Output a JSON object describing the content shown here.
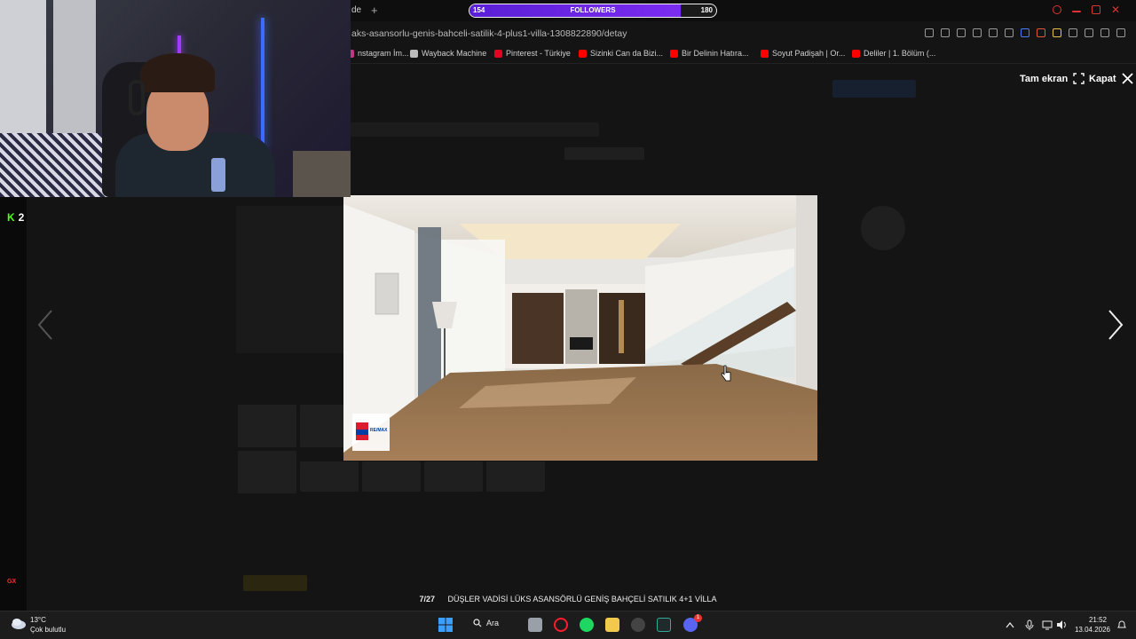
{
  "stream": {
    "followers_label": "FOLLOWERS",
    "followers_current": "154",
    "followers_goal": "180",
    "followers_progress": 0.855,
    "kick_viewers": "2"
  },
  "browser": {
    "tab_fragment": "de",
    "url": "aks-asansorlu-genis-bahceli-satilik-4-plus1-villa-1308822890/detay",
    "bookmarks": [
      {
        "label": "nstagram İm...",
        "icon": "instagram-icon",
        "color": "#c13584"
      },
      {
        "label": "Wayback Machine",
        "icon": "wayback-icon",
        "color": "#bbbbbb"
      },
      {
        "label": "Pinterest - Türkiye",
        "icon": "pinterest-icon",
        "color": "#e60023"
      },
      {
        "label": "Sizinki Can da Bizi...",
        "icon": "youtube-icon",
        "color": "#ff0000"
      },
      {
        "label": "Bir Delinin Hatıra...",
        "icon": "youtube-icon",
        "color": "#ff0000"
      },
      {
        "label": "Soyut Padişah | Or...",
        "icon": "youtube-icon",
        "color": "#ff0000"
      },
      {
        "label": "Deliler | 1. Bölüm (...",
        "icon": "youtube-icon",
        "color": "#ff0000"
      }
    ]
  },
  "lightbox": {
    "fullscreen_label": "Tam ekran",
    "close_label": "Kapat",
    "counter": "7/27",
    "caption": "DÜŞLER VADİSİ LÜKS ASANSÖRLÜ GENİŞ BAHÇELİ SATILIK 4+1 VİLLA",
    "watermark_brand": "RE/MAX"
  },
  "taskbar": {
    "temperature": "13°C",
    "weather": "Çok bulutlu",
    "search_label": "Ara",
    "time": "21:52",
    "date": "13.04.2026",
    "discord_badge": "1"
  },
  "sidebar": {
    "gx_label": "GX"
  },
  "colors": {
    "accent_purple": "#7b2cf0",
    "kick_green": "#53fc18",
    "remax_red": "#dc1c2e",
    "remax_blue": "#003da5"
  }
}
